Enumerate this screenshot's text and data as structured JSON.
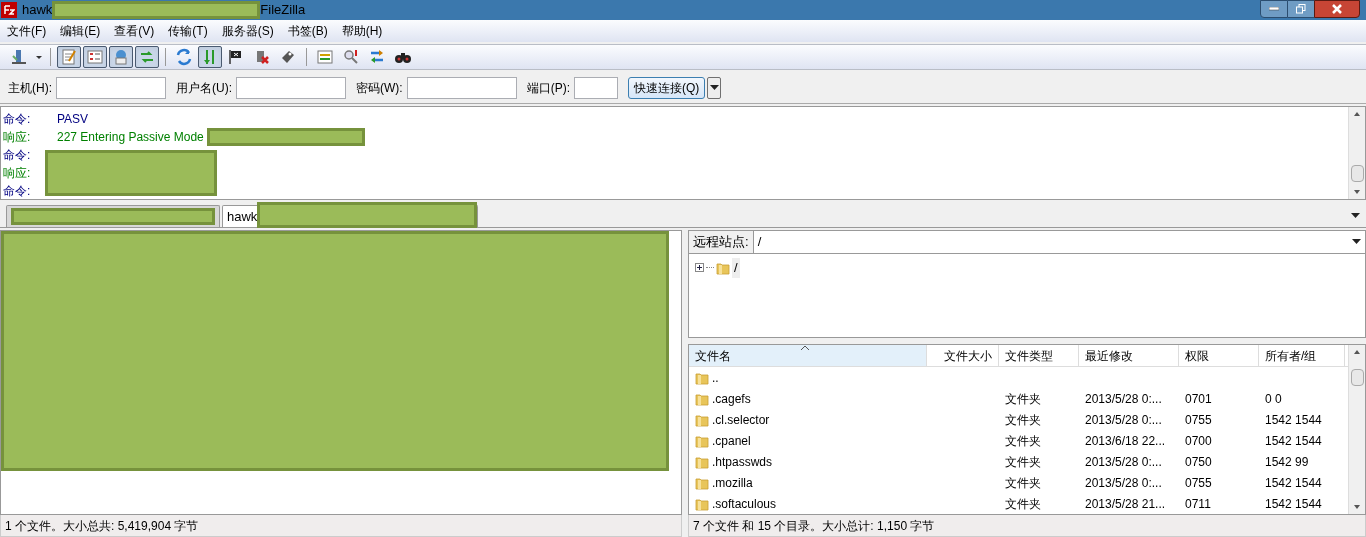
{
  "window": {
    "title_start": "hawk",
    "title_end": "FileZilla"
  },
  "menu": [
    {
      "label": "文件(F)"
    },
    {
      "label": "编辑(E)"
    },
    {
      "label": "查看(V)"
    },
    {
      "label": "传输(T)"
    },
    {
      "label": "服务器(S)"
    },
    {
      "label": "书签(B)"
    },
    {
      "label": "帮助(H)"
    }
  ],
  "toolbar": [
    [
      {
        "kind": "site",
        "pressed": false
      },
      {
        "kind": "caret",
        "pressed": false
      }
    ],
    [
      {
        "kind": "log",
        "pressed": true
      },
      {
        "kind": "tree",
        "pressed": true
      },
      {
        "kind": "remote",
        "pressed": true
      },
      {
        "kind": "queue",
        "pressed": true
      }
    ],
    [
      {
        "kind": "refresh",
        "pressed": false
      },
      {
        "kind": "process",
        "pressed": true
      },
      {
        "kind": "flag",
        "pressed": false
      },
      {
        "kind": "cancel",
        "pressed": false
      },
      {
        "kind": "stamp",
        "pressed": false
      }
    ],
    [
      {
        "kind": "filter",
        "pressed": false
      },
      {
        "kind": "compare",
        "pressed": false
      },
      {
        "kind": "sync",
        "pressed": false
      },
      {
        "kind": "find",
        "pressed": false
      }
    ]
  ],
  "quickconnect": {
    "fields": [
      {
        "label": "主机(H):"
      },
      {
        "label": "用户名(U):"
      },
      {
        "label": "密码(W):"
      },
      {
        "label": "端口(P):"
      }
    ],
    "button": "快速连接(Q)"
  },
  "log": [
    {
      "kind": "command",
      "label": "命令:",
      "text": "PASV"
    },
    {
      "kind": "response",
      "label": "响应:",
      "text": "227 Entering Passive Mode"
    },
    {
      "kind": "command",
      "label": "命令:"
    },
    {
      "kind": "response",
      "label": "响应:"
    },
    {
      "kind": "command",
      "label": "命令:"
    }
  ],
  "tabs": [
    {
      "selected": false
    },
    {
      "label": "hawk",
      "selected": true
    }
  ],
  "remote": {
    "site_label": "远程站点:",
    "path": "/",
    "tree": [
      {
        "label": "/",
        "expanded": false
      }
    ],
    "columns": [
      "文件名",
      "文件大小",
      "文件类型",
      "最近修改",
      "权限",
      "所有者/组"
    ],
    "rows": [
      {
        "name": ".."
      },
      {
        "name": ".cagefs",
        "type": "文件夹",
        "modified": "2013/5/28 0:...",
        "perms": "0701",
        "owner": "0 0"
      },
      {
        "name": ".cl.selector",
        "type": "文件夹",
        "modified": "2013/5/28 0:...",
        "perms": "0755",
        "owner": "1542 1544"
      },
      {
        "name": ".cpanel",
        "type": "文件夹",
        "modified": "2013/6/18 22...",
        "perms": "0700",
        "owner": "1542 1544"
      },
      {
        "name": ".htpasswds",
        "type": "文件夹",
        "modified": "2013/5/28 0:...",
        "perms": "0750",
        "owner": "1542 99"
      },
      {
        "name": ".mozilla",
        "type": "文件夹",
        "modified": "2013/5/28 0:...",
        "perms": "0755",
        "owner": "1542 1544"
      },
      {
        "name": ".softaculous",
        "type": "文件夹",
        "modified": "2013/5/28 21...",
        "perms": "0711",
        "owner": "1542 1544"
      }
    ],
    "status": "7 个文件 和 15 个目录。大小总计: 1,150 字节"
  },
  "local": {
    "status": "1 个文件。大小总共: 5,419,904 字节"
  }
}
